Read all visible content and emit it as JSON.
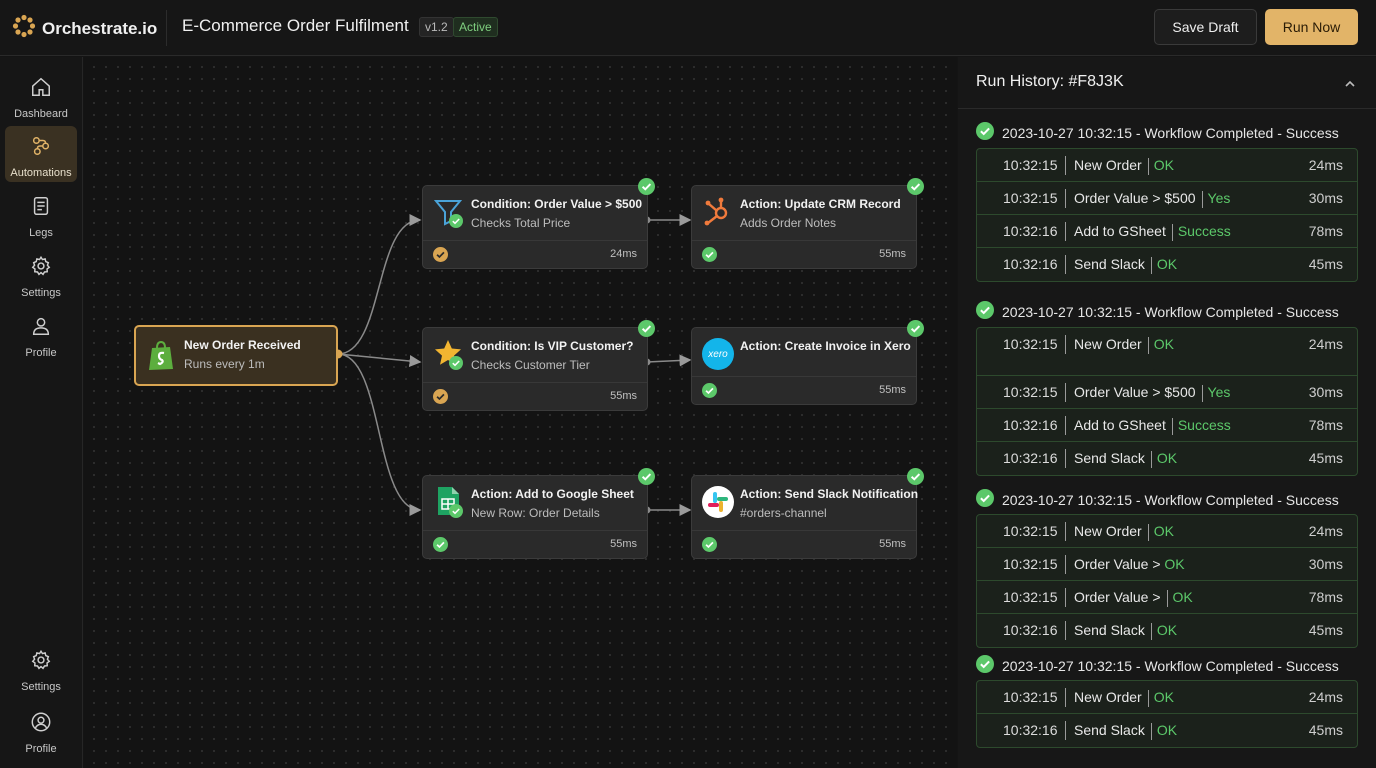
{
  "app": {
    "name": "Orchestrate.io"
  },
  "header": {
    "workflow_title": "E-Commerce Order Fulfilment",
    "version": "v1.2",
    "status": "Active",
    "save_label": "Save Draft",
    "run_label": "Run Now",
    "accent": "#e2b468"
  },
  "sidebar": {
    "items": [
      {
        "label": "Dashbeard",
        "icon": "home-icon"
      },
      {
        "label": "Automations",
        "icon": "automations-icon",
        "active": true
      },
      {
        "label": "Legs",
        "icon": "logs-icon"
      },
      {
        "label": "Settings",
        "icon": "gear-icon"
      },
      {
        "label": "Profile",
        "icon": "user-icon"
      }
    ],
    "bottom": [
      {
        "label": "Settings",
        "icon": "gear-icon"
      },
      {
        "label": "Profile",
        "icon": "user-circle-icon"
      }
    ]
  },
  "canvas": {
    "trigger": {
      "title": "New Order Received",
      "subtitle": "Runs every 1m",
      "icon": "shopify-icon"
    },
    "nodes": [
      {
        "title": "Condition: Order Value > $500",
        "subtitle": "Checks Total Price",
        "ms": "24ms",
        "icon": "filter-icon",
        "footer_status": "warning"
      },
      {
        "title": "Action: Update CRM Record",
        "subtitle": "Adds Order Notes",
        "ms": "55ms",
        "icon": "hubspot-icon",
        "footer_status": "success"
      },
      {
        "title": "Condition: Is VIP Customer?",
        "subtitle": "Checks Customer Tier",
        "ms": "55ms",
        "icon": "star-icon",
        "footer_status": "warning"
      },
      {
        "title": "Action: Create Invoice in Xero",
        "subtitle": "",
        "ms": "55ms",
        "icon": "xero-icon",
        "icon_text": "xero",
        "footer_status": "success"
      },
      {
        "title": "Action: Add to Google Sheet",
        "subtitle": "New Row: Order Details",
        "ms": "55ms",
        "icon": "google-sheets-icon",
        "footer_status": "success"
      },
      {
        "title": "Action: Send Slack Notification",
        "subtitle": "#orders-channel",
        "ms": "55ms",
        "icon": "slack-icon",
        "footer_status": "success"
      }
    ]
  },
  "run_history": {
    "title": "Run History: #F8J3K",
    "runs": [
      {
        "header": "2023-10-27 10:32:15 - Workflow Completed - Success",
        "rows": [
          {
            "time": "10:32:15",
            "name": "New Order",
            "result": "OK",
            "ms": "24ms"
          },
          {
            "time": "10:32:15",
            "name": "Order Value > $500",
            "result": "Yes",
            "ms": "30ms"
          },
          {
            "time": "10:32:16",
            "name": "Add to GSheet",
            "result": "Success",
            "ms": "78ms"
          },
          {
            "time": "10:32:16",
            "name": "Send Slack",
            "result": "OK",
            "ms": "45ms"
          }
        ]
      },
      {
        "header": "2023-10-27 10:32:15 - Workflow Completed - Success",
        "rows": [
          {
            "time": "10:32:15",
            "name": "New Order",
            "result": "OK",
            "ms": "24ms"
          },
          {
            "time": "10:32:15",
            "name": "Order Value > $500",
            "result": "Yes",
            "ms": "30ms"
          },
          {
            "time": "10:32:16",
            "name": "Add to GSheet",
            "result": "Success",
            "ms": "78ms"
          },
          {
            "time": "10:32:16",
            "name": "Send Slack",
            "result": "OK",
            "ms": "45ms"
          }
        ]
      },
      {
        "header": "2023-10-27 10:32:15 - Workflow Completed - Success",
        "rows": [
          {
            "time": "10:32:15",
            "name": "New Order",
            "result": "OK",
            "ms": "24ms"
          },
          {
            "time": "10:32:15",
            "name": "Order Value >",
            "result": "OK",
            "ms": "30ms"
          },
          {
            "time": "10:32:15",
            "name": "Order Value >",
            "result": "OK",
            "ms": "78ms"
          },
          {
            "time": "10:32:16",
            "name": "Send Slack",
            "result": "OK",
            "ms": "45ms"
          }
        ]
      },
      {
        "header": "2023-10-27 10:32:15 - Workflow Completed - Success",
        "rows": [
          {
            "time": "10:32:15",
            "name": "New Order",
            "result": "OK",
            "ms": "24ms"
          },
          {
            "time": "10:32:16",
            "name": "Send Slack",
            "result": "OK",
            "ms": "45ms"
          }
        ]
      }
    ]
  },
  "colors": {
    "success": "#5cc86a",
    "warning": "#d9a552",
    "panel_border": "#2d4a2d"
  }
}
